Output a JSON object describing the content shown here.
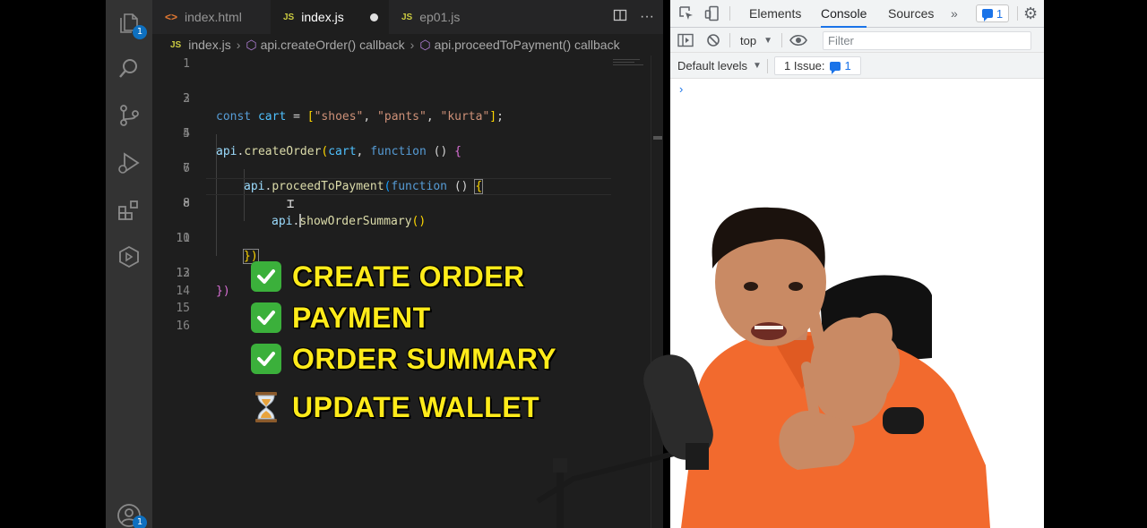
{
  "editor": {
    "tabs": [
      {
        "icon": "<>",
        "label": "index.html"
      },
      {
        "icon": "JS",
        "label": "index.js"
      },
      {
        "icon": "JS",
        "label": "ep01.js"
      }
    ],
    "breadcrumb": {
      "file_icon": "JS",
      "file": "index.js",
      "item1": "api.createOrder() callback",
      "item2": "api.proceedToPayment() callback"
    },
    "explorer_badge": "1",
    "account_badge": "1",
    "line_numbers": [
      "1",
      "2",
      "3",
      "4",
      "5",
      "6",
      "7",
      "8",
      "9",
      "10",
      "11",
      "12",
      "13",
      "14",
      "15",
      "16"
    ]
  },
  "code": {
    "l2": {
      "kw": "const",
      "name": "cart",
      "eq": " = ",
      "open": "[",
      "s1": "\"shoes\"",
      "s2": "\"pants\"",
      "s3": "\"kurta\"",
      "comma": ", ",
      "close": "]",
      "semi": ";"
    },
    "l4": {
      "obj": "api",
      "dot": ".",
      "fn": "createOrder",
      "open": "(",
      "arg": "cart",
      "comma": ", ",
      "kw": "function",
      "params": " () ",
      "brace": "{"
    },
    "l6": {
      "obj": "api",
      "dot": ".",
      "fn": "proceedToPayment",
      "open": "(",
      "kw": "function",
      "params": " () ",
      "brace": "{"
    },
    "l8": {
      "obj": "api",
      "dot": ".",
      "s": "s",
      "fn_rest": "howOrderSummary",
      "parens": "()"
    },
    "l10": {
      "text": "})"
    },
    "l12": {
      "text": "})"
    }
  },
  "checklist": [
    {
      "status": "done",
      "label": "CREATE ORDER"
    },
    {
      "status": "done",
      "label": "PAYMENT"
    },
    {
      "status": "done",
      "label": "ORDER SUMMARY"
    },
    {
      "status": "pending",
      "label": "UPDATE WALLET"
    }
  ],
  "devtools": {
    "tabs": [
      "Elements",
      "Console",
      "Sources"
    ],
    "more": "»",
    "issues_badge": "1",
    "context": "top",
    "filter_placeholder": "Filter",
    "levels": "Default levels",
    "issues_text": "1 Issue:",
    "issues_count": "1",
    "prompt": "›"
  },
  "colors": {
    "checklist_text": "#ffeb1a",
    "check_green": "#3bb03b",
    "devtools_accent": "#1a73e8",
    "presenter_shirt": "#f26a2e"
  }
}
